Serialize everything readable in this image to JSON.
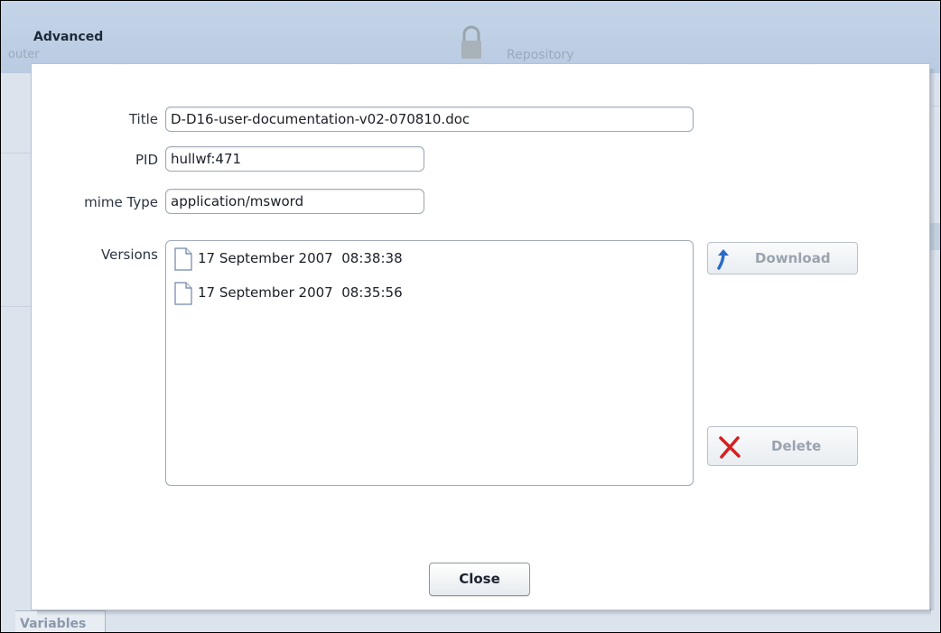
{
  "background": {
    "header_title": "Advanced",
    "computer_label": "outer",
    "repository_label": "Repository",
    "variables_tab": "Variables"
  },
  "dialog": {
    "title_label": "Title",
    "title_value": "D-D16-user-documentation-v02-070810.doc",
    "pid_label": "PID",
    "pid_value": "hullwf:471",
    "mime_label": "mime Type",
    "mime_value": "application/msword",
    "versions_label": "Versions",
    "versions": [
      {
        "label": "17 September 2007  08:38:38",
        "icon": "document-icon"
      },
      {
        "label": "17 September 2007  08:35:56",
        "icon": "document-icon"
      }
    ],
    "download_label": "Download",
    "delete_label": "Delete",
    "close_label": "Close"
  }
}
